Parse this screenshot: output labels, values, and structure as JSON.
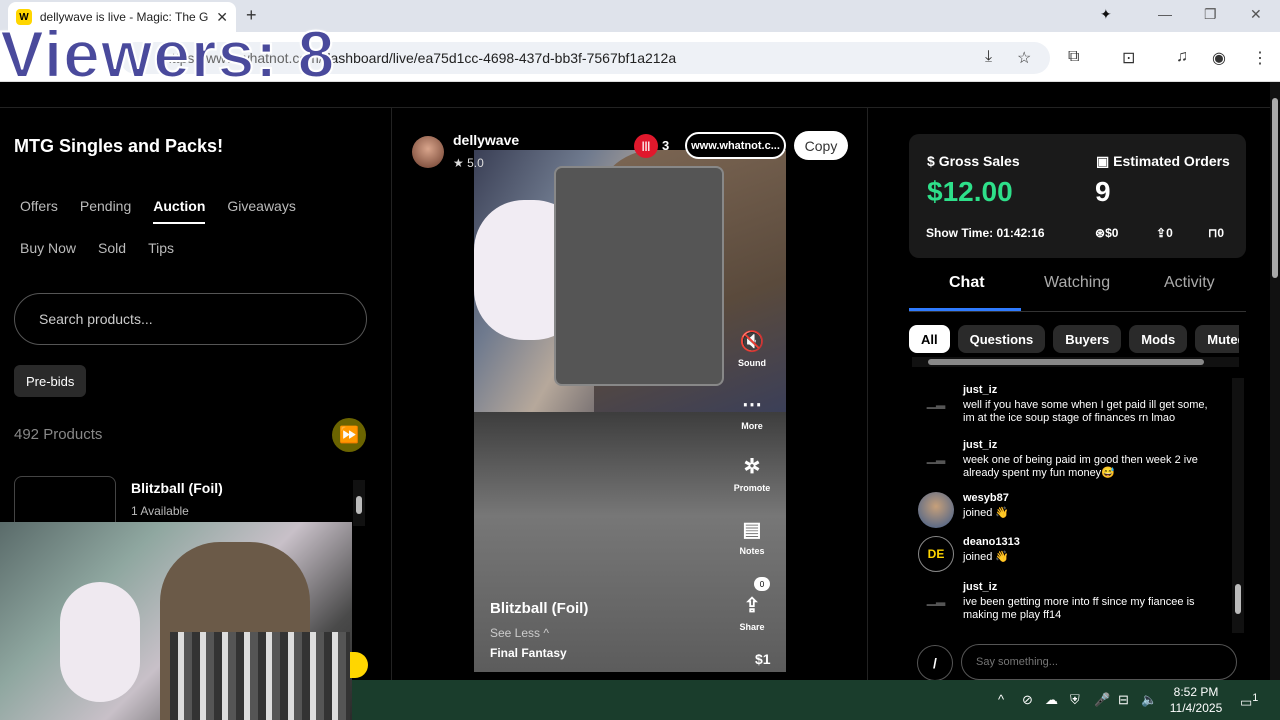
{
  "overlay": {
    "viewers_text": "Viewers: 8"
  },
  "browser": {
    "tab_title": "dellywave is live - Magic: The Ga",
    "tab_favicon": "W",
    "url_prefix": "https://www.whatnot.com/",
    "url_rest": "dashboard/live/ea75d1cc-4698-437d-bb3f-7567bf1a212a"
  },
  "left": {
    "show_title": "MTG Singles and Packs!",
    "tabs_row1": [
      "Offers",
      "Pending",
      "Auction",
      "Giveaways"
    ],
    "active_tab": "Auction",
    "tabs_row2": [
      "Buy Now",
      "Sold",
      "Tips"
    ],
    "search_placeholder": "Search products...",
    "prebids_label": "Pre-bids",
    "product_count": "492 Products",
    "product": {
      "name": "Blitzball (Foil)",
      "availability": "1 Available"
    }
  },
  "center": {
    "streamer_name": "dellywave",
    "rating": "5.0",
    "live_count": "3",
    "link_text": "www.whatnot.c...",
    "copy_label": "Copy",
    "actions": {
      "sound": "Sound",
      "more": "More",
      "promote": "Promote",
      "notes": "Notes",
      "share": "Share"
    },
    "share_count": "0",
    "item_title": "Blitzball (Foil)",
    "see_less": "See Less",
    "item_subtitle": "Final Fantasy",
    "price": "$1"
  },
  "stats": {
    "gross_label": "Gross Sales",
    "gross_value": "$12.00",
    "orders_label": "Estimated Orders",
    "orders_value": "9",
    "showtime_label": "Show Time:",
    "showtime_value": "01:42:16",
    "tips": "$0",
    "shares": "0",
    "saves": "0"
  },
  "chat": {
    "tabs": [
      "Chat",
      "Watching",
      "Activity"
    ],
    "filters": [
      "All",
      "Questions",
      "Buyers",
      "Mods",
      "Muted"
    ],
    "messages": [
      {
        "user": "just_iz",
        "text": "well if you have some when I get paid ill get some, im at the ice soup stage of finances rn lmao"
      },
      {
        "user": "just_iz",
        "text": "week one of being paid im good then week 2 ive already spent my fun money😅"
      },
      {
        "user": "wesyb87",
        "text": "joined 👋"
      },
      {
        "user": "deano1313",
        "avatar_initials": "DE",
        "text": "joined 👋"
      },
      {
        "user": "just_iz",
        "text": "ive been getting more into ff since my fiancee is making me play ff14"
      }
    ],
    "say_placeholder": "Say something..."
  },
  "taskbar": {
    "time": "8:52 PM",
    "date": "11/4/2025",
    "notification_count": "1"
  }
}
